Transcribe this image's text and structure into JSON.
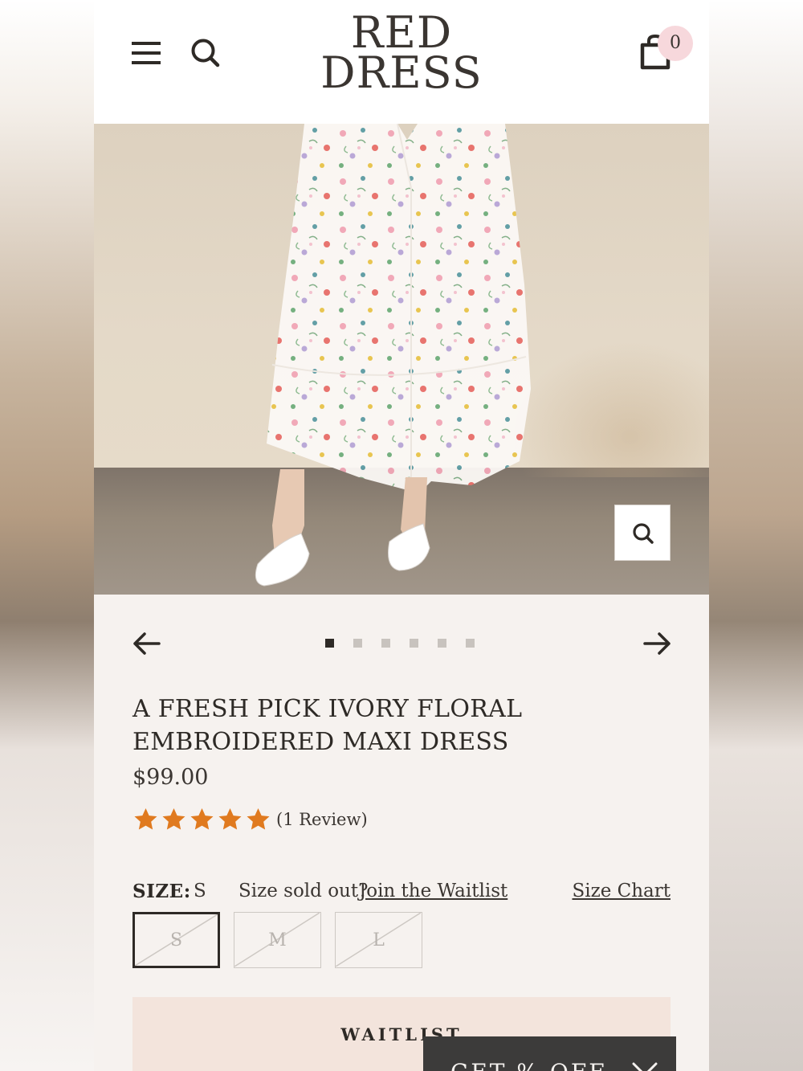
{
  "header": {
    "logo_line1": "RED",
    "logo_line2": "DRESS",
    "cart_count": "0"
  },
  "icons": {
    "menu": "hamburger-icon",
    "search": "search-icon",
    "cart": "cart-icon",
    "zoom": "zoom-icon",
    "prev": "arrow-left-icon",
    "next": "arrow-right-icon",
    "close": "close-icon"
  },
  "carousel": {
    "total_images": 6,
    "active_index": 0
  },
  "product": {
    "title": "A FRESH PICK IVORY FLORAL EMBROIDERED MAXI DRESS",
    "price": "$99.00",
    "rating": 5,
    "reviews_label": "(1 Review)"
  },
  "size": {
    "label": "SIZE:",
    "selected": "S",
    "sold_out_text": "Size sold out?",
    "waitlist_link": "Join the Waitlist",
    "size_chart": "Size Chart",
    "options": [
      "S",
      "M",
      "L"
    ]
  },
  "actions": {
    "waitlist_button": "WAITLIST",
    "promo_text": "GET   % OFF"
  },
  "colors": {
    "star": "#e07a1f",
    "cart_badge": "#f7d8dc",
    "waitlist_bg": "#f3e4dc",
    "promo_bg": "#3c3b3a"
  }
}
